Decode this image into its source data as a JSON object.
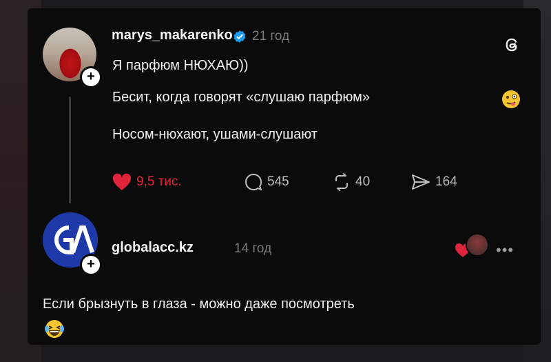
{
  "post": {
    "username": "marys_makarenko",
    "time": "21 год",
    "lines": [
      "Я парфюм НЮХАЮ))",
      "Бесит, когда говорят «слушаю парфюм»",
      "Носом-нюхают, ушами-слушают"
    ],
    "actions": {
      "likes": "9,5 тис.",
      "comments": "545",
      "reposts": "40",
      "shares": "164"
    },
    "icons": [
      "heart-icon",
      "comment-icon",
      "repost-icon",
      "share-icon",
      "threads-logo-icon",
      "verified-badge-icon",
      "woozy-face-emoji"
    ],
    "colors": {
      "like": "#e0243b",
      "verified": "#1d9bf0",
      "background": "#0b0b0c"
    }
  },
  "reply": {
    "username": "globalacc.kz",
    "time": "14 год",
    "text": "Если брызнуть в глаза - можно даже посмотреть",
    "avatar_text": "GA",
    "icons": [
      "liked-by-author-icon",
      "more-options-icon",
      "laughing-crying-emoji"
    ]
  }
}
